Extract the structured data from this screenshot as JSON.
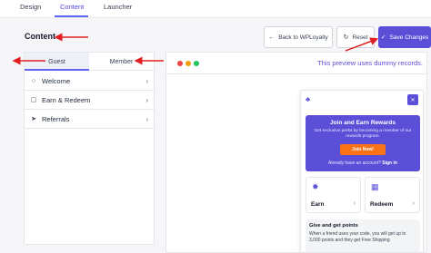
{
  "top_tabs": {
    "design": "Design",
    "content": "Content",
    "launcher": "Launcher"
  },
  "page": {
    "title": "Content"
  },
  "header_buttons": {
    "back": "Back to WPLoyalty",
    "reset": "Reset",
    "save": "Save Changes"
  },
  "role_tabs": {
    "guest": "Guest",
    "member": "Member"
  },
  "sidebar": {
    "items": [
      {
        "label": "Welcome",
        "icon": "chat-bubble-icon"
      },
      {
        "label": "Earn & Redeem",
        "icon": "coin-icon"
      },
      {
        "label": "Referrals",
        "icon": "send-icon"
      }
    ]
  },
  "preview": {
    "note": "This preview uses dummy records.",
    "dots": [
      "#ef4444",
      "#f59e0b",
      "#22c55e"
    ]
  },
  "widget": {
    "join": {
      "title": "Join and Earn Rewards",
      "description": "Get exclusive perks by becoming a member of our rewards program.",
      "button": "Join Now!",
      "footer_text": "Already have an account?",
      "footer_link": "Sign in"
    },
    "earn": "Earn",
    "redeem": "Redeem",
    "give": {
      "title": "Give and get points",
      "description": "When a friend uses your code, you will get up to 3,000 points and they get Free Shipping"
    }
  },
  "colors": {
    "accent": "#5b4fd8",
    "annotation": "#e02020",
    "join_button": "#f97316"
  }
}
